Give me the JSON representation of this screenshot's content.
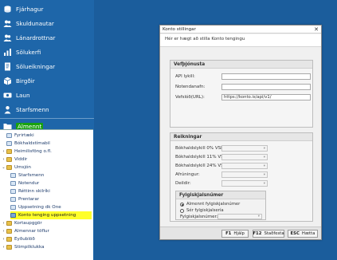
{
  "sidebar": {
    "items": [
      {
        "label": "Fjárhagur",
        "icon": "coins-icon"
      },
      {
        "label": "Skuldunautar",
        "icon": "users-icon"
      },
      {
        "label": "Lánardrottnar",
        "icon": "users-icon"
      },
      {
        "label": "Sölukerfi",
        "icon": "chart-icon"
      },
      {
        "label": "Sölueikningar",
        "icon": "invoice-icon"
      },
      {
        "label": "Birgðir",
        "icon": "box-icon"
      },
      {
        "label": "Laun",
        "icon": "money-icon"
      },
      {
        "label": "Starfsmenn",
        "icon": "person-icon"
      },
      {
        "label": "Almennt",
        "icon": "folder-icon"
      }
    ],
    "active_index": 8
  },
  "tree": {
    "nodes": [
      {
        "label": "Fyrirtæki",
        "level": 1,
        "icon": "doc",
        "expander": ""
      },
      {
        "label": "Bókhaldstímabil",
        "level": 1,
        "icon": "doc",
        "expander": ""
      },
      {
        "label": "Heimilisföng o.fl.",
        "level": 1,
        "icon": "folder",
        "expander": "›"
      },
      {
        "label": "Viddir",
        "level": 1,
        "icon": "folder",
        "expander": "›"
      },
      {
        "label": "Umsjón",
        "level": 1,
        "icon": "folder",
        "expander": "⌄"
      },
      {
        "label": "Starfsmenn",
        "level": 2,
        "icon": "doc",
        "expander": ""
      },
      {
        "label": "Notendur",
        "level": 2,
        "icon": "doc",
        "expander": ""
      },
      {
        "label": "Réttinn skilríki",
        "level": 2,
        "icon": "doc",
        "expander": ""
      },
      {
        "label": "Prentarar",
        "level": 2,
        "icon": "doc",
        "expander": ""
      },
      {
        "label": "Uppsetning dk One",
        "level": 2,
        "icon": "doc",
        "expander": ""
      },
      {
        "label": "Konto tenging uppsetning",
        "level": 2,
        "icon": "gear",
        "expander": "",
        "highlighted": true
      },
      {
        "label": "Kortaupggör",
        "level": 1,
        "icon": "folder",
        "expander": "›"
      },
      {
        "label": "Almennar töflur",
        "level": 1,
        "icon": "folder",
        "expander": "›"
      },
      {
        "label": "Eyðublöð",
        "level": 1,
        "icon": "folder",
        "expander": "›"
      },
      {
        "label": "Stimpilklukka",
        "level": 1,
        "icon": "folder",
        "expander": "›"
      }
    ]
  },
  "dialog": {
    "title": "Konto stillingar",
    "close": "✕",
    "info": "Hér er hægt að stilla Konto tengingu",
    "web_service": {
      "title": "Vefþjónusta",
      "api_key_label": "API lykill:",
      "username_label": "Notendanafn:",
      "url_label": "Vefslóð(URL):",
      "api_key_value": "",
      "username_value": "",
      "url_value": "https://konto.is/api/v1/"
    },
    "accounts": {
      "title": "Reikningar",
      "vat0_label": "Bókhaldslykill 0% VSK:",
      "vat11_label": "Bókhaldslykill 11% VSK:",
      "vat24_label": "Bókhaldslykill 24% VSK:",
      "project_label": "Afrúningur:",
      "department_label": "Deildir:",
      "attachments": {
        "title": "Fylgiskjalsnúmer",
        "option_general": "Almennt fylgiskjalsnúmer",
        "option_series": "Sér fylgiskjalsería",
        "number_label": "Fylgiskjalsnúmer:",
        "selected": "general"
      }
    },
    "footer": {
      "help_key": "F1",
      "help_label": "Hjálp",
      "confirm_key": "F12",
      "confirm_label": "Staðfesta",
      "cancel_key": "ESC",
      "cancel_label": "Hætta"
    }
  },
  "colors": {
    "background": "#1b5d9c",
    "sidebar": "#1e66a9",
    "active_highlight": "#17a10f",
    "tree_highlight": "#ffff2a"
  }
}
